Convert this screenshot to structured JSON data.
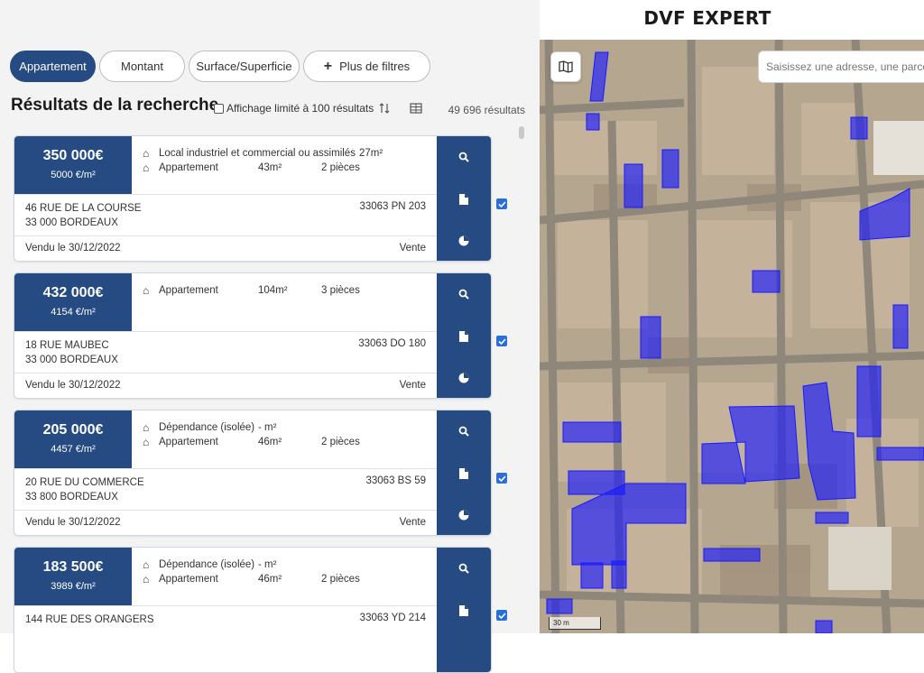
{
  "app_title": "DVF EXPERT",
  "filters": [
    {
      "label": "Appartement",
      "active": true
    },
    {
      "label": "Montant",
      "active": false
    },
    {
      "label": "Surface/Superficie",
      "active": false
    },
    {
      "label": "Plus de filtres",
      "active": false,
      "icon": "plus-icon"
    }
  ],
  "results": {
    "title": "Résultats de la recherche",
    "limit_label": "Affichage limité à 100 résultats",
    "limit_checked": false,
    "count": "49 696 résultats"
  },
  "cards": [
    {
      "price": "350 000€",
      "price_per_m2": "5000 €/m²",
      "properties": [
        {
          "type": "Local industriel et commercial ou assimilés",
          "surface": "27m²",
          "rooms": ""
        },
        {
          "type": "Appartement",
          "surface": "43m²",
          "rooms": "2 pièces"
        }
      ],
      "address_line1": "46 RUE DE LA COURSE",
      "address_line2": "33 000 BORDEAUX",
      "parcel": "33063 PN 203",
      "sold_date": "Vendu le 30/12/2022",
      "nature": "Vente",
      "selected": true
    },
    {
      "price": "432 000€",
      "price_per_m2": "4154 €/m²",
      "properties": [
        {
          "type": "Appartement",
          "surface": "104m²",
          "rooms": "3 pièces"
        }
      ],
      "address_line1": "18 RUE MAUBEC",
      "address_line2": "33 000 BORDEAUX",
      "parcel": "33063 DO 180",
      "sold_date": "Vendu le 30/12/2022",
      "nature": "Vente",
      "selected": true
    },
    {
      "price": "205 000€",
      "price_per_m2": "4457 €/m²",
      "properties": [
        {
          "type": "Dépendance (isolée)",
          "surface": "- m²",
          "rooms": ""
        },
        {
          "type": "Appartement",
          "surface": "46m²",
          "rooms": "2 pièces"
        }
      ],
      "address_line1": "20 RUE DU COMMERCE",
      "address_line2": "33 800 BORDEAUX",
      "parcel": "33063 BS 59",
      "sold_date": "Vendu le 30/12/2022",
      "nature": "Vente",
      "selected": true
    },
    {
      "price": "183 500€",
      "price_per_m2": "3989 €/m²",
      "properties": [
        {
          "type": "Dépendance (isolée)",
          "surface": "- m²",
          "rooms": ""
        },
        {
          "type": "Appartement",
          "surface": "46m²",
          "rooms": "2 pièces"
        }
      ],
      "address_line1": "144 RUE DES ORANGERS",
      "address_line2": "",
      "parcel": "33063 YD 214",
      "sold_date": "",
      "nature": "",
      "selected": true
    }
  ],
  "map": {
    "search_placeholder": "Saisissez une adresse, une parcelle, ...",
    "scale_label": "30 m",
    "layer_icon": "map-layers-icon",
    "highlight_color": "#1a1aff"
  },
  "colors": {
    "primary": "#264b82",
    "checkbox": "#2a6fd6"
  }
}
